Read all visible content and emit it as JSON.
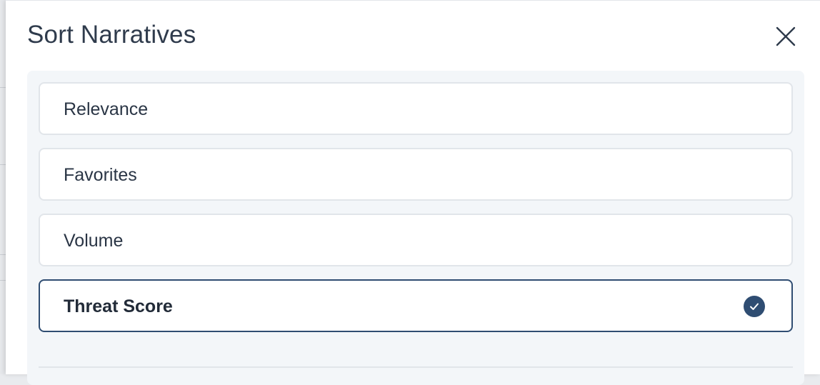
{
  "dialog": {
    "title": "Sort Narratives",
    "close_icon": "close-icon"
  },
  "sort_options": [
    {
      "label": "Relevance",
      "selected": false
    },
    {
      "label": "Favorites",
      "selected": false
    },
    {
      "label": "Volume",
      "selected": false
    },
    {
      "label": "Threat Score",
      "selected": true
    }
  ],
  "colors": {
    "accent": "#2f4d72",
    "title_text": "#2f3b4c",
    "panel_background": "#f3f6f9",
    "option_border": "#e1e5ea"
  },
  "selected_icon": "check-circle-icon"
}
